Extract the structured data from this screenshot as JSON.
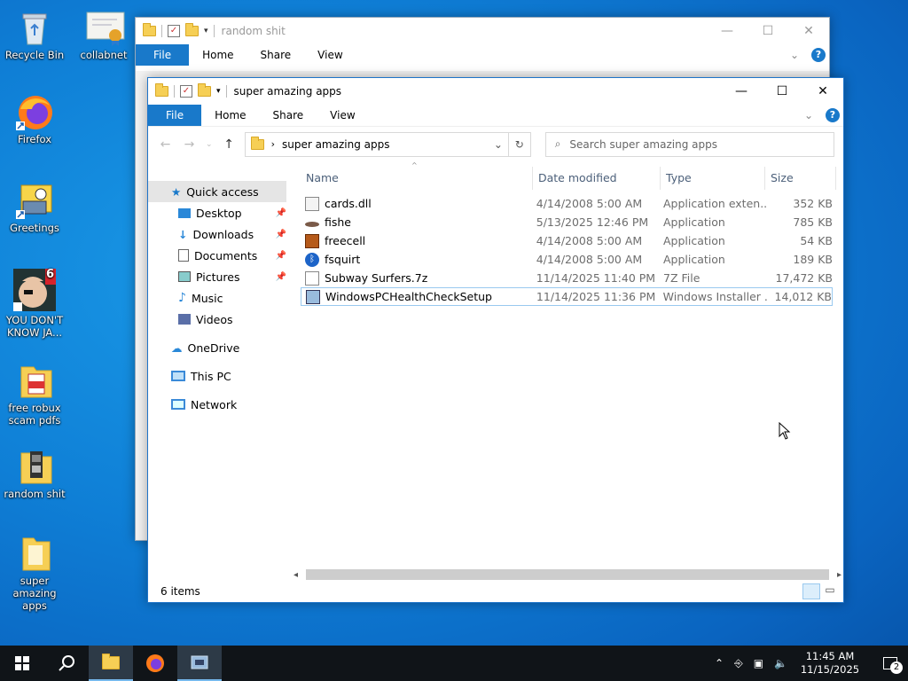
{
  "desktop": {
    "icons": [
      {
        "label": "Recycle Bin"
      },
      {
        "label": "collabnet"
      },
      {
        "label": "Firefox"
      },
      {
        "label": "Greetings"
      },
      {
        "label": "YOU DON'T KNOW JA..."
      },
      {
        "label": "free robux scam pdfs"
      },
      {
        "label": "random shit"
      },
      {
        "label": "super amazing apps"
      }
    ],
    "badge_number": "6"
  },
  "back_window": {
    "title": "random shit",
    "tabs": [
      "File",
      "Home",
      "Share",
      "View"
    ]
  },
  "window": {
    "title": "super amazing apps",
    "tabs": [
      "File",
      "Home",
      "Share",
      "View"
    ],
    "address": "super amazing apps",
    "search_placeholder": "Search super amazing apps",
    "sidebar": [
      {
        "label": "Quick access",
        "icon": "star-icon"
      },
      {
        "label": "Desktop",
        "icon": "desktop-icon"
      },
      {
        "label": "Downloads",
        "icon": "download-icon"
      },
      {
        "label": "Documents",
        "icon": "documents-icon"
      },
      {
        "label": "Pictures",
        "icon": "pictures-icon"
      },
      {
        "label": "Music",
        "icon": "music-icon"
      },
      {
        "label": "Videos",
        "icon": "videos-icon"
      },
      {
        "label": "OneDrive",
        "icon": "cloud-icon"
      },
      {
        "label": "This PC",
        "icon": "pc-icon"
      },
      {
        "label": "Network",
        "icon": "network-icon"
      }
    ],
    "columns": [
      "Name",
      "Date modified",
      "Type",
      "Size"
    ],
    "files": [
      {
        "name": "cards.dll",
        "date": "4/14/2008 5:00 AM",
        "type": "Application exten...",
        "size": "352 KB"
      },
      {
        "name": "fishe",
        "date": "5/13/2025 12:46 PM",
        "type": "Application",
        "size": "785 KB"
      },
      {
        "name": "freecell",
        "date": "4/14/2008 5:00 AM",
        "type": "Application",
        "size": "54 KB"
      },
      {
        "name": "fsquirt",
        "date": "4/14/2008 5:00 AM",
        "type": "Application",
        "size": "189 KB"
      },
      {
        "name": "Subway Surfers.7z",
        "date": "11/14/2025 11:40 PM",
        "type": "7Z File",
        "size": "17,472 KB"
      },
      {
        "name": "WindowsPCHealthCheckSetup",
        "date": "11/14/2025 11:36 PM",
        "type": "Windows Installer ...",
        "size": "14,012 KB"
      }
    ],
    "status": "6 items"
  },
  "taskbar": {
    "time": "11:45 AM",
    "date": "11/15/2025",
    "notification_count": "2"
  },
  "colors": {
    "accent": "#1979ca",
    "taskbar": "#101418",
    "desktop": "#0f7fd6"
  }
}
